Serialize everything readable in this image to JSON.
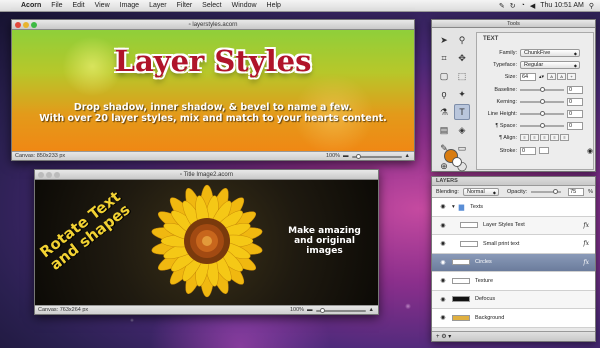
{
  "menubar": {
    "apple": "",
    "app": "Acorn",
    "items": [
      "File",
      "Edit",
      "View",
      "Image",
      "Layer",
      "Filter",
      "Select",
      "Window",
      "Help"
    ],
    "clock": "Thu 10:51 AM"
  },
  "win1": {
    "title": "layerstyles.acorn",
    "heading": "Layer Styles",
    "sub1": "Drop shadow, inner shadow, & bevel to name a few.",
    "sub2": "With over 20 layer styles, mix and match to your hearts content.",
    "status": "Canvas: 850x233 px",
    "zoom": "100%"
  },
  "win2": {
    "title": "Title Image2.acorn",
    "rot1": "Rotate Text",
    "rot2": "and shapes",
    "make1": "Make amazing",
    "make2": "and original",
    "make3": "images",
    "status": "Canvas: 763x264 px",
    "zoom": "100%"
  },
  "tools": {
    "title": "Tools",
    "panel_title": "TEXT",
    "family_label": "Family:",
    "family": "ChunkFive",
    "typeface_label": "Typeface:",
    "typeface": "Regular",
    "size_label": "Size:",
    "size": "64",
    "baseline_label": "Baseline:",
    "baseline": "0",
    "kerning_label": "Kerning:",
    "kerning": "0",
    "lineheight_label": "Line Height:",
    "lineheight": "0",
    "space_label": "¶ Space:",
    "space": "0",
    "align_label": "¶ Align:",
    "stroke_label": "Stroke:",
    "stroke": "0"
  },
  "layers": {
    "title": "LAYERS",
    "blending_label": "Blending:",
    "blending": "Normal",
    "opacity_label": "Opacity:",
    "opacity": "75",
    "rows": [
      {
        "name": "Texts",
        "color": "#5a8ed6"
      },
      {
        "name": "Layer Styles Text",
        "color": "#ffffff"
      },
      {
        "name": "Small print text",
        "color": "#ffffff"
      },
      {
        "name": "Circles",
        "color": "#ffffff"
      },
      {
        "name": "Texture",
        "color": "#ffffff"
      },
      {
        "name": "Defocus",
        "color": "#111111"
      },
      {
        "name": "Background",
        "color": "#e0b040"
      }
    ]
  }
}
